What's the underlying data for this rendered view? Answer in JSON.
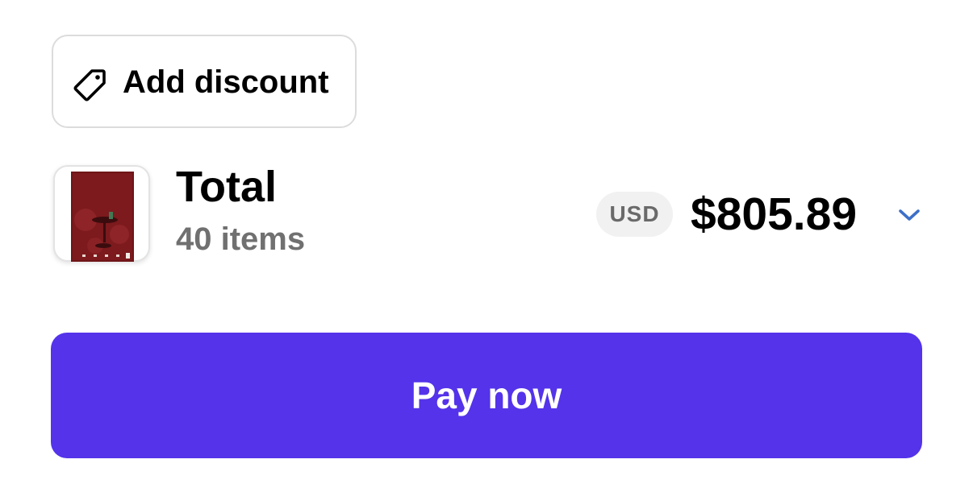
{
  "discount": {
    "label": "Add discount",
    "icon": "tag-icon"
  },
  "order": {
    "thumbnail_icon": "product-thumbnail",
    "total_label": "Total",
    "items_count": "40 items",
    "currency": "USD",
    "amount": "$805.89",
    "expand_icon": "chevron-down-icon"
  },
  "pay": {
    "label": "Pay now"
  },
  "colors": {
    "accent": "#5433ea",
    "chevron": "#3d6fc8",
    "muted_text": "#707070",
    "badge_bg": "#f1f1f1"
  }
}
